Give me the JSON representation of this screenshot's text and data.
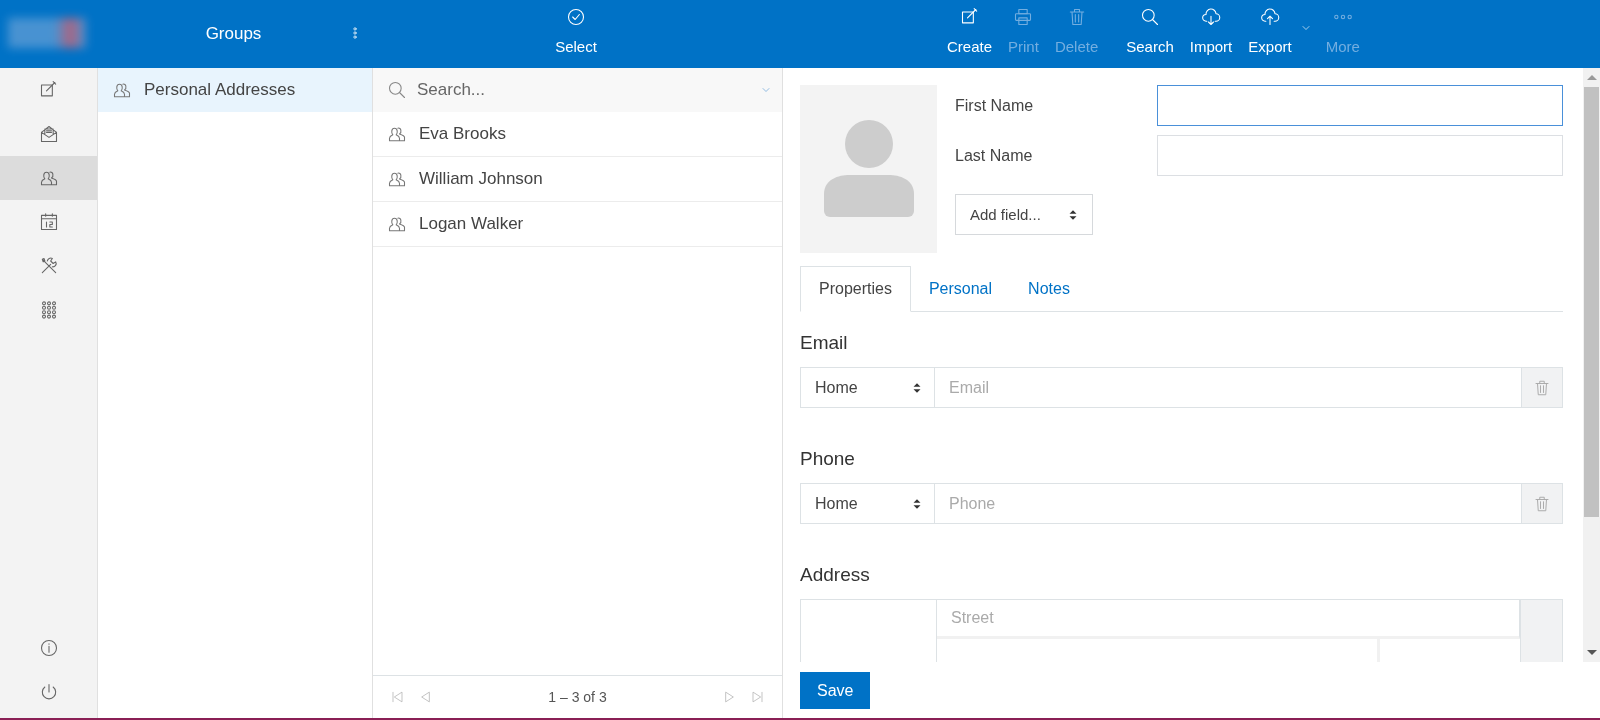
{
  "header": {
    "groups_title": "Groups",
    "select_label": "Select",
    "action_groups": [
      {
        "items": [
          {
            "label": "Create",
            "disabled": false,
            "has_menu": false
          },
          {
            "label": "Print",
            "disabled": true,
            "has_menu": false
          },
          {
            "label": "Delete",
            "disabled": true,
            "has_menu": false
          }
        ]
      },
      {
        "items": [
          {
            "label": "Search",
            "disabled": false,
            "has_menu": false
          },
          {
            "label": "Import",
            "disabled": false,
            "has_menu": false
          },
          {
            "label": "Export",
            "disabled": false,
            "has_menu": true
          },
          {
            "label": "More",
            "disabled": true,
            "has_menu": false
          }
        ]
      }
    ]
  },
  "rail": {
    "items": [
      {
        "selected": false
      },
      {
        "selected": false
      },
      {
        "selected": true
      },
      {
        "selected": false
      },
      {
        "selected": false
      },
      {
        "selected": false
      }
    ],
    "bottom_items": [
      {
        "selected": false
      },
      {
        "selected": false
      }
    ]
  },
  "groups": [
    {
      "label": "Personal Addresses",
      "selected": true
    }
  ],
  "contacts": {
    "search": {
      "placeholder": "Search..."
    },
    "items": [
      {
        "name": "Eva Brooks",
        "selected": false
      },
      {
        "name": "William Johnson",
        "selected": false
      },
      {
        "name": "Logan Walker",
        "selected": false
      }
    ],
    "pager": "1 – 3 of 3"
  },
  "detail": {
    "first_name_label": "First Name",
    "last_name_label": "Last Name",
    "add_field": "Add field...",
    "tabs": [
      {
        "label": "Properties",
        "selected": true
      },
      {
        "label": "Personal",
        "selected": false
      },
      {
        "label": "Notes",
        "selected": false
      }
    ],
    "sections": [
      {
        "kind": "line",
        "title": "Email",
        "type": "Home",
        "placeholder": "Email"
      },
      {
        "kind": "line",
        "title": "Phone",
        "type": "Home",
        "placeholder": "Phone"
      },
      {
        "kind": "address",
        "title": "Address",
        "placeholder": "Street"
      }
    ],
    "save": "Save"
  }
}
